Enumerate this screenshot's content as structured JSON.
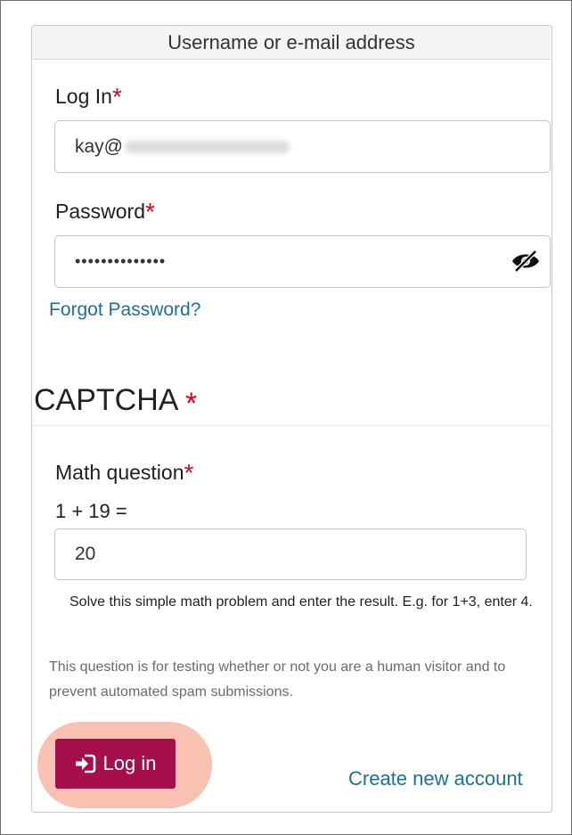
{
  "form": {
    "header": "Username or e-mail address",
    "login": {
      "label": "Log In",
      "required_mark": "*",
      "value": "kay@"
    },
    "password": {
      "label": "Password",
      "required_mark": "*",
      "masked_value": "••••••••••••••",
      "toggle_icon": "eye-slash-icon"
    },
    "forgot_password": "Forgot Password?",
    "captcha": {
      "title": "CAPTCHA",
      "required_mark": "*",
      "question_label": "Math question",
      "question_required_mark": "*",
      "expression": "1 + 19 =",
      "answer": "20",
      "help": "Solve this simple math problem and enter the result. E.g. for 1+3, enter 4.",
      "info": "This question is for testing whether or not you are a human visitor and to prevent automated spam submissions."
    },
    "submit": {
      "label": "Log in",
      "icon": "sign-in-icon",
      "color": "#a70f4c"
    },
    "create_account": "Create new account"
  },
  "colors": {
    "link": "#1a6fa3",
    "required": "#e8001c",
    "highlight": "#f7b6a5"
  }
}
